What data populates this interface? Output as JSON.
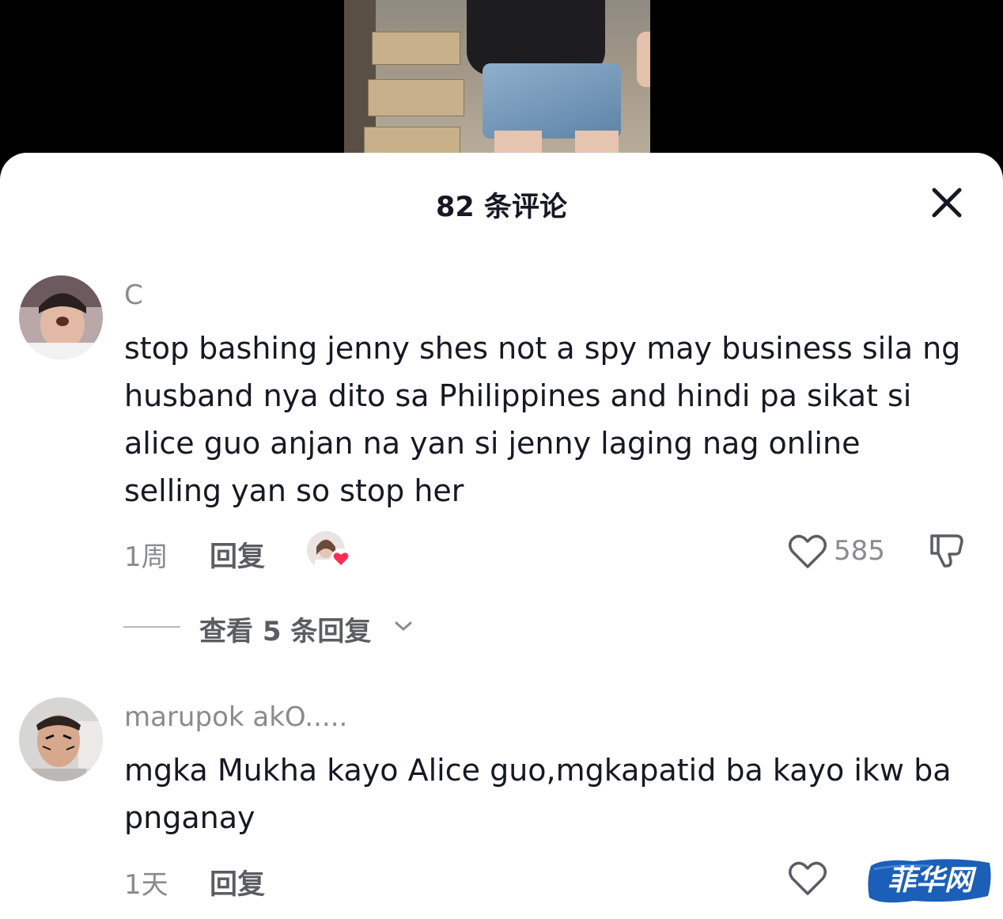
{
  "header": {
    "title": "82 条评论"
  },
  "icons": {
    "close": "close-icon",
    "like": "heart-outline-icon",
    "dislike": "thumbs-down-icon",
    "chevron": "chevron-down-icon"
  },
  "comments": [
    {
      "username": "C",
      "text": "stop bashing jenny shes not a spy may business sila ng husband nya dito sa Philippines and hindi pa sikat si alice guo anjan na yan si jenny laging nag online selling yan so stop her",
      "time": "1周",
      "reply_label": "回复",
      "like_count": "585",
      "view_replies_label": "查看 5 条回复"
    },
    {
      "username": "marupok akO.....",
      "text": "mgka Mukha kayo Alice guo,mgkapatid ba kayo ikw ba pnganay",
      "time": "1天",
      "reply_label": "回复"
    }
  ],
  "watermark": {
    "text": "菲华网"
  },
  "colors": {
    "primary_text": "#161823",
    "secondary_text": "#8a8b91",
    "heart_red": "#fe2c55",
    "watermark_blue": "#1b5fb8"
  }
}
